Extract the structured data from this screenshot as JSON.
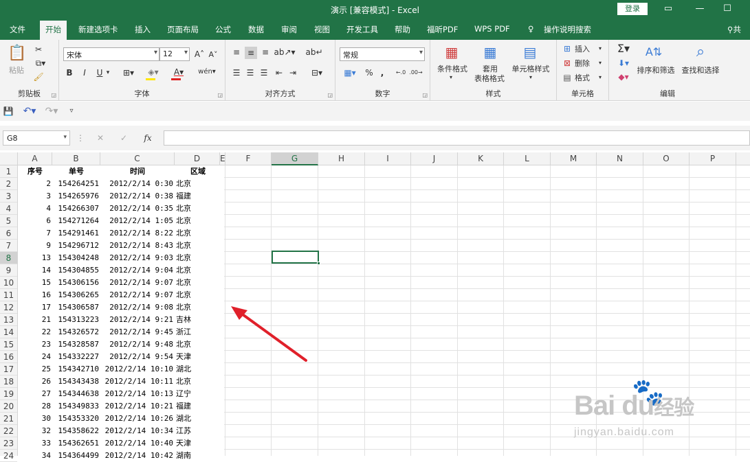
{
  "window": {
    "title": "演示  [兼容模式]  -  Excel",
    "login_label": "登录"
  },
  "tabs": [
    "文件",
    "开始",
    "新建选项卡",
    "插入",
    "页面布局",
    "公式",
    "数据",
    "审阅",
    "视图",
    "开发工具",
    "帮助",
    "福昕PDF",
    "WPS PDF",
    "操作说明搜索",
    "共"
  ],
  "active_tab": "开始",
  "ribbon": {
    "clipboard": {
      "label": "剪贴板",
      "paste": "粘贴"
    },
    "font": {
      "label": "字体",
      "font_name": "宋体",
      "font_size": "12",
      "bold": "B",
      "italic": "I",
      "underline": "U"
    },
    "alignment": {
      "label": "对齐方式"
    },
    "number": {
      "label": "数字",
      "format": "常规",
      "percent": "%",
      "comma": ","
    },
    "styles": {
      "label": "样式",
      "conditional": "条件格式",
      "table_format_1": "套用",
      "table_format_2": "表格格式",
      "cell_style": "单元格样式"
    },
    "cells": {
      "label": "单元格",
      "insert": "插入",
      "delete": "删除",
      "format": "格式"
    },
    "editing": {
      "label": "编辑",
      "sort": "排序和筛选",
      "find": "查找和选择"
    }
  },
  "namebox": "G8",
  "fx": "fx",
  "columns": [
    "A",
    "B",
    "C",
    "D",
    "E",
    "F",
    "G",
    "H",
    "I",
    "J",
    "K",
    "L",
    "M",
    "N",
    "O",
    "P"
  ],
  "selected_column": "G",
  "selected_row": 8,
  "rows": [
    "1",
    "2",
    "3",
    "4",
    "5",
    "6",
    "7",
    "8",
    "9",
    "10",
    "11",
    "12",
    "13",
    "14",
    "15",
    "16",
    "17",
    "18",
    "19",
    "20",
    "21",
    "22",
    "23",
    "24"
  ],
  "header": [
    "序号",
    "单号",
    "时间",
    "区域"
  ],
  "data": [
    [
      "2",
      "154264251",
      "2012/2/14 0:30",
      "北京"
    ],
    [
      "3",
      "154265976",
      "2012/2/14 0:38",
      "福建"
    ],
    [
      "4",
      "154266307",
      "2012/2/14 0:35",
      "北京"
    ],
    [
      "6",
      "154271264",
      "2012/2/14 1:05",
      "北京"
    ],
    [
      "7",
      "154291461",
      "2012/2/14 8:22",
      "北京"
    ],
    [
      "9",
      "154296712",
      "2012/2/14 8:43",
      "北京"
    ],
    [
      "13",
      "154304248",
      "2012/2/14 9:03",
      "北京"
    ],
    [
      "14",
      "154304855",
      "2012/2/14 9:04",
      "北京"
    ],
    [
      "15",
      "154306156",
      "2012/2/14 9:07",
      "北京"
    ],
    [
      "16",
      "154306265",
      "2012/2/14 9:07",
      "北京"
    ],
    [
      "17",
      "154306587",
      "2012/2/14 9:08",
      "北京"
    ],
    [
      "21",
      "154313223",
      "2012/2/14 9:21",
      "吉林"
    ],
    [
      "22",
      "154326572",
      "2012/2/14 9:45",
      "浙江"
    ],
    [
      "23",
      "154328587",
      "2012/2/14 9:48",
      "北京"
    ],
    [
      "24",
      "154332227",
      "2012/2/14 9:54",
      "天津"
    ],
    [
      "25",
      "154342710",
      "2012/2/14 10:10",
      "湖北"
    ],
    [
      "26",
      "154343438",
      "2012/2/14 10:11",
      "北京"
    ],
    [
      "27",
      "154344638",
      "2012/2/14 10:13",
      "辽宁"
    ],
    [
      "28",
      "154349833",
      "2012/2/14 10:21",
      "福建"
    ],
    [
      "30",
      "154353320",
      "2012/2/14 10:26",
      "湖北"
    ],
    [
      "32",
      "154358622",
      "2012/2/14 10:34",
      "江苏"
    ],
    [
      "33",
      "154362651",
      "2012/2/14 10:40",
      "天津"
    ],
    [
      "34",
      "154364499",
      "2012/2/14 10:42",
      "湖南"
    ]
  ],
  "watermark": {
    "brand": "Bai  du",
    "suffix": "经验",
    "url": "jingyan.baidu.com"
  },
  "colors": {
    "accent": "#217346",
    "arrow": "#e0202a"
  }
}
